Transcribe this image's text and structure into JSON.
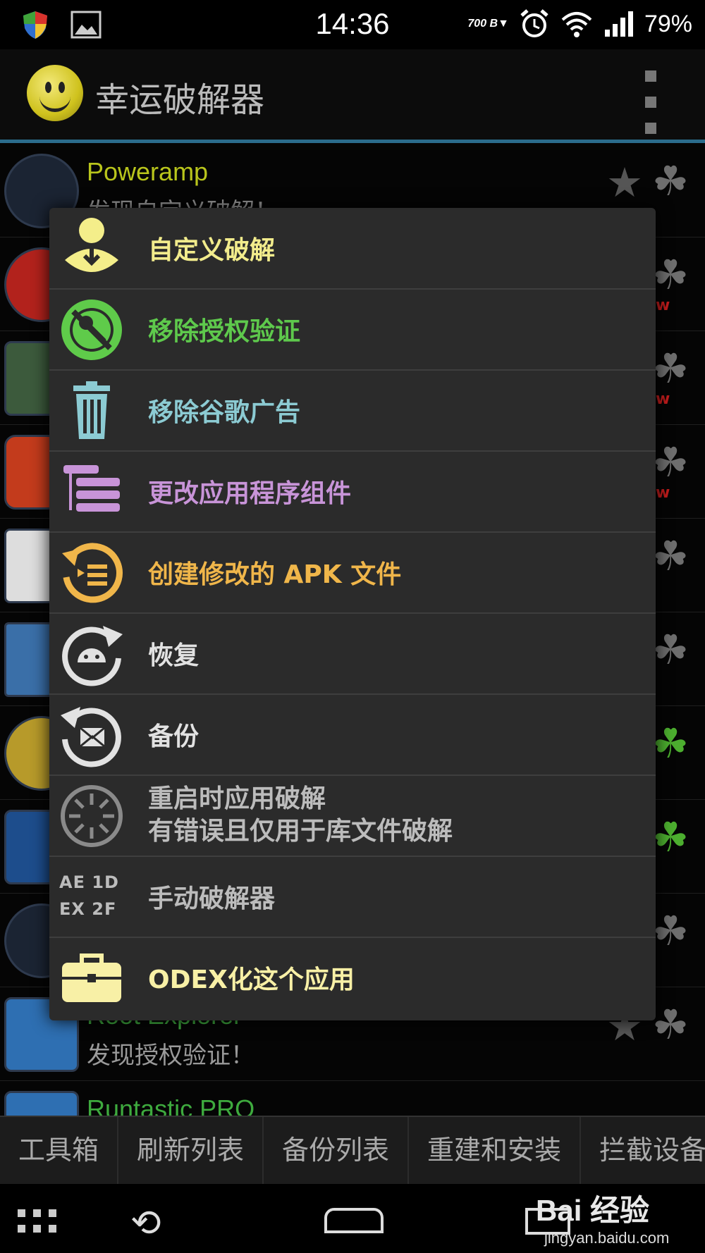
{
  "status_bar": {
    "time": "14:36",
    "net_speed": "700 B▼",
    "battery": "79%",
    "icons": [
      "shield-icon",
      "image-icon",
      "alarm-icon",
      "wifi-icon",
      "signal-icon",
      "battery-icon"
    ]
  },
  "app_bar": {
    "title": "幸运破解器",
    "logo_icon": "smiley-icon",
    "overflow_icon": "overflow-menu-icon"
  },
  "app_list": [
    {
      "name": "Poweramp",
      "status": "发现自定义破解！",
      "has_w": true,
      "clover": "grey"
    },
    {
      "name": "",
      "status": "",
      "has_w": true,
      "clover": "grey"
    },
    {
      "name": "",
      "status": "",
      "has_w": true,
      "clover": "grey"
    },
    {
      "name": "",
      "status": "",
      "has_w": true,
      "clover": "grey"
    },
    {
      "name": "",
      "status": "",
      "has_w": false,
      "clover": "grey"
    },
    {
      "name": "",
      "status": "",
      "has_w": false,
      "clover": "grey"
    },
    {
      "name": "",
      "status": "",
      "has_w": false,
      "clover": "green"
    },
    {
      "name": "",
      "status": "",
      "has_w": false,
      "clover": "green"
    },
    {
      "name": "",
      "status": "",
      "has_w": false,
      "clover": "grey"
    },
    {
      "name": "Root Explorer",
      "status": "发现授权验证！",
      "has_w": false,
      "clover": "grey"
    },
    {
      "name": "Runtastic PRO",
      "status": "",
      "has_w": false,
      "clover": "grey"
    }
  ],
  "row_w_mark": "w",
  "context_menu": {
    "items": [
      {
        "label": "自定义破解",
        "icon": "custom-patch-person-icon",
        "color": "#f2ec8c"
      },
      {
        "label": "移除授权验证",
        "icon": "remove-license-key-icon",
        "color": "#5ec94c"
      },
      {
        "label": "移除谷歌广告",
        "icon": "trash-icon",
        "color": "#8ccbd3"
      },
      {
        "label": "更改应用程序组件",
        "icon": "components-list-icon",
        "color": "#c894d8"
      },
      {
        "label": "创建修改的 APK 文件",
        "icon": "create-apk-icon",
        "color": "#f0b64a"
      },
      {
        "label": "恢复",
        "icon": "restore-android-icon",
        "color": "#e2e2e2"
      },
      {
        "label": "备份",
        "icon": "backup-mail-icon",
        "color": "#e2e2e2"
      },
      {
        "label_line1": "重启时应用破解",
        "label_line2": "有错误且仅用于库文件破解",
        "icon": "reboot-spinner-icon",
        "color": "#bcbcbc"
      },
      {
        "label": "手动破解器",
        "icon_text_1": "AE 1D",
        "icon_text_2": "EX 2F",
        "icon": "hex-code-icon",
        "color": "#bcbcbc"
      },
      {
        "label": "ODEX化这个应用",
        "icon": "toolbox-icon",
        "color": "#f8f0a6"
      }
    ]
  },
  "toolbar": {
    "buttons": [
      "工具箱",
      "刷新列表",
      "备份列表",
      "重建和安装",
      "拦截设备"
    ]
  },
  "watermark": {
    "main": "Bai 经验",
    "sub": "jingyan.baidu.com"
  }
}
